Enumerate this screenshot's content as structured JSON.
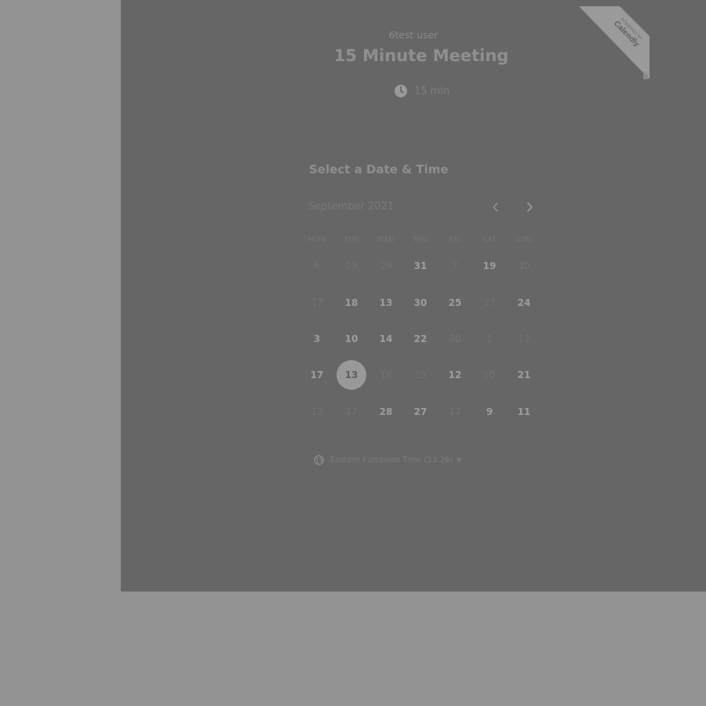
{
  "organizer": "6test user",
  "event": {
    "title": "15 Minute Meeting",
    "duration": "15 min"
  },
  "section_title": "Select a Date & Time",
  "calendar": {
    "month_label": "September 2021",
    "weekdays": [
      "MON",
      "TUE",
      "WED",
      "THU",
      "FRI",
      "SAT",
      "SUN"
    ],
    "rows": [
      [
        {
          "label": "6",
          "state": "muted"
        },
        {
          "label": "29",
          "state": "muted"
        },
        {
          "label": "29",
          "state": "muted"
        },
        {
          "label": "31",
          "state": "active"
        },
        {
          "label": "7",
          "state": "muted"
        },
        {
          "label": "19",
          "state": "active"
        },
        {
          "label": "30",
          "state": "muted"
        }
      ],
      [
        {
          "label": "17",
          "state": "muted"
        },
        {
          "label": "18",
          "state": "active"
        },
        {
          "label": "13",
          "state": "active"
        },
        {
          "label": "30",
          "state": "active"
        },
        {
          "label": "25",
          "state": "active"
        },
        {
          "label": "17",
          "state": "muted"
        },
        {
          "label": "24",
          "state": "active"
        }
      ],
      [
        {
          "label": "3",
          "state": "active"
        },
        {
          "label": "10",
          "state": "active"
        },
        {
          "label": "14",
          "state": "active"
        },
        {
          "label": "22",
          "state": "active"
        },
        {
          "label": "30",
          "state": "muted"
        },
        {
          "label": "1",
          "state": "muted"
        },
        {
          "label": "12",
          "state": "muted"
        }
      ],
      [
        {
          "label": "17",
          "state": "active"
        },
        {
          "label": "13",
          "state": "selected"
        },
        {
          "label": "18",
          "state": "muted"
        },
        {
          "label": "13",
          "state": "muted"
        },
        {
          "label": "12",
          "state": "active"
        },
        {
          "label": "10",
          "state": "muted"
        },
        {
          "label": "21",
          "state": "active"
        }
      ],
      [
        {
          "label": "13",
          "state": "muted"
        },
        {
          "label": "17",
          "state": "muted"
        },
        {
          "label": "28",
          "state": "active"
        },
        {
          "label": "27",
          "state": "active"
        },
        {
          "label": "17",
          "state": "muted"
        },
        {
          "label": "9",
          "state": "active"
        },
        {
          "label": "11",
          "state": "active"
        }
      ]
    ]
  },
  "timezone": "Eastern European Time (13:26)",
  "badge": {
    "line1": "POWERED BY",
    "line2": "Calendly"
  },
  "icons": {
    "clock": "clock-icon",
    "globe": "globe-icon",
    "prev": "chevron-left-icon",
    "next": "chevron-right-icon"
  }
}
